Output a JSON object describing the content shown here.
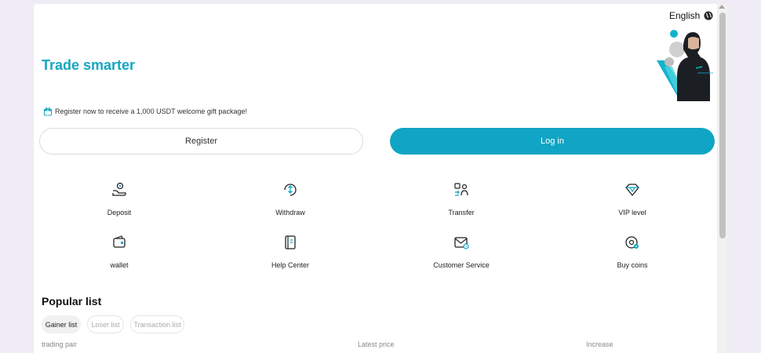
{
  "header": {
    "language": "English",
    "title": "Trade smarter",
    "promo_text": "Register now to receive a 1,000 USDT welcome gift package!"
  },
  "auth": {
    "register_label": "Register",
    "login_label": "Log in"
  },
  "actions": [
    {
      "label": "Deposit",
      "icon": "deposit-icon"
    },
    {
      "label": "Withdraw",
      "icon": "withdraw-icon"
    },
    {
      "label": "Transfer",
      "icon": "transfer-icon"
    },
    {
      "label": "VIP level",
      "icon": "diamond-icon"
    },
    {
      "label": "wallet",
      "icon": "wallet-icon"
    },
    {
      "label": "Help Center",
      "icon": "help-center-icon"
    },
    {
      "label": "Customer Service",
      "icon": "customer-service-icon"
    },
    {
      "label": "Buy coins",
      "icon": "buy-coins-icon"
    }
  ],
  "popular": {
    "title": "Popular list",
    "tabs": [
      {
        "label": "Gainer list",
        "active": true
      },
      {
        "label": "Loser list",
        "active": false
      },
      {
        "label": "Transaction list",
        "active": false
      }
    ],
    "columns": [
      "trading pair",
      "Latest price",
      "Increase"
    ]
  },
  "colors": {
    "accent": "#10a5c4",
    "title": "#15a6c1"
  }
}
